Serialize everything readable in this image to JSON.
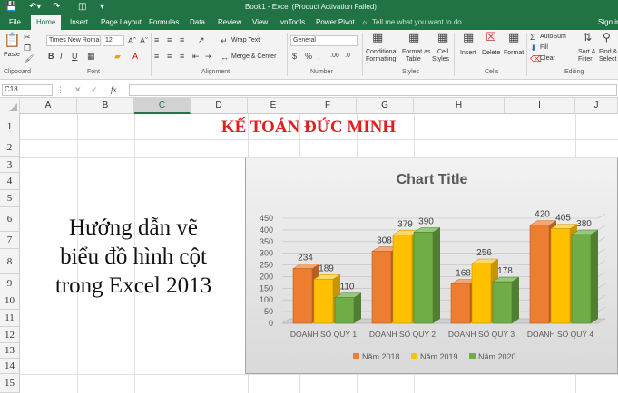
{
  "titlebar": {
    "title": "Book1 - Excel (Product Activation Failed)"
  },
  "tabs": [
    "File",
    "Home",
    "Insert",
    "Page Layout",
    "Formulas",
    "Data",
    "Review",
    "View",
    "vnTools",
    "Power Pivot"
  ],
  "tell_me": "Tell me what you want to do...",
  "sign_in": "Sign in",
  "ribbon": {
    "clipboard": {
      "paste": "Paste",
      "label": "Clipboard"
    },
    "font": {
      "name": "Times New Roma",
      "size": "12",
      "label": "Font"
    },
    "alignment": {
      "wrap": "Wrap Text",
      "merge": "Merge & Center",
      "label": "Alignment"
    },
    "number": {
      "format": "General",
      "label": "Number"
    },
    "styles": {
      "cond1": "Conditional",
      "cond2": "Formatting",
      "fmt1": "Format as",
      "fmt2": "Table",
      "cell1": "Cell",
      "cell2": "Styles",
      "label": "Styles"
    },
    "cells": {
      "insert": "Insert",
      "delete": "Delete",
      "format": "Format",
      "label": "Cells"
    },
    "editing": {
      "autosum": "AutoSum",
      "fill": "Fill",
      "clear": "Clear",
      "sort1": "Sort &",
      "sort2": "Filter",
      "find1": "Find &",
      "find2": "Select",
      "label": "Editing"
    }
  },
  "formula_bar": {
    "name_box": "C18",
    "fx": "fx",
    "value": ""
  },
  "columns": [
    "A",
    "B",
    "C",
    "D",
    "E",
    "F",
    "G",
    "H",
    "I",
    "J"
  ],
  "selected_column": "C",
  "rows": [
    "1",
    "2",
    "3",
    "4",
    "5",
    "6",
    "7",
    "8",
    "9",
    "10",
    "11",
    "12",
    "13",
    "14",
    "15"
  ],
  "sheet": {
    "banner": "KẾ TOÁN ĐỨC MINH",
    "heading_lines": [
      "Hướng dẫn vẽ",
      "biểu đồ hình cột",
      "trong Excel 2013"
    ]
  },
  "colors": {
    "excel_green": "#217346",
    "banner_red": "#e02020",
    "s2018": "#ed7d31",
    "s2019": "#ffc000",
    "s2020": "#70ad47"
  },
  "chart_data": {
    "type": "bar",
    "title": "Chart Title",
    "categories": [
      "DOANH SỐ QUÝ 1",
      "DOANH SỐ QUÝ 2",
      "DOANH SỐ QUÝ 3",
      "DOANH SỐ QUÝ 4"
    ],
    "series": [
      {
        "name": "Năm 2018",
        "values": [
          234,
          308,
          168,
          420
        ]
      },
      {
        "name": "Năm 2019",
        "values": [
          189,
          379,
          256,
          405
        ]
      },
      {
        "name": "Năm 2020",
        "values": [
          110,
          390,
          178,
          380
        ]
      }
    ],
    "ylim": [
      0,
      450
    ],
    "yticks": [
      "0",
      "50",
      "100",
      "150",
      "200",
      "250",
      "300",
      "350",
      "400",
      "450"
    ],
    "grid": true,
    "legend": "bottom",
    "style": "3d-column"
  }
}
